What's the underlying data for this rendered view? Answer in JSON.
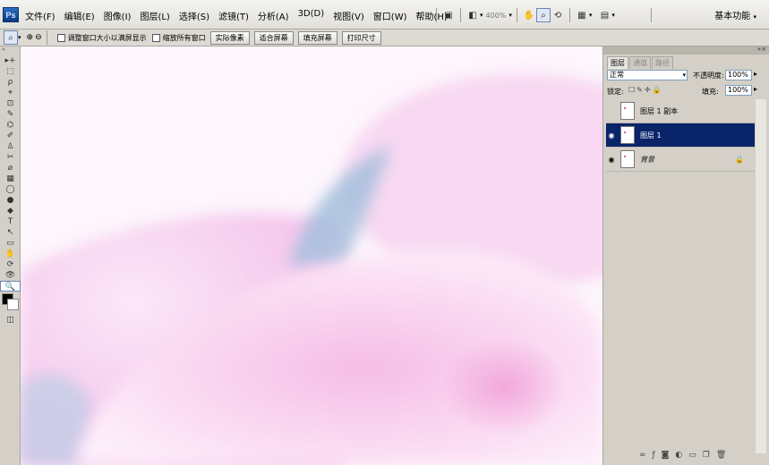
{
  "app": {
    "logo": "Ps"
  },
  "menu": [
    "文件(F)",
    "编辑(E)",
    "图像(I)",
    "图层(L)",
    "选择(S)",
    "滤镜(T)",
    "分析(A)",
    "3D(D)",
    "视图(V)",
    "窗口(W)",
    "帮助(H)"
  ],
  "menubar_tools": {
    "zoom_level": "400%",
    "workspace": "基本功能"
  },
  "options": {
    "check_resize": "调整窗口大小以满屏显示",
    "check_zoom_all": "缩放所有窗口",
    "btn_actual": "实际像素",
    "btn_fit": "适合屏幕",
    "btn_fill": "填充屏幕",
    "btn_print": "打印尺寸"
  },
  "tools": [
    "▸+",
    "⬚",
    "ρ",
    "⌖",
    "⊡",
    "✎",
    "⌬",
    "✐",
    "♙",
    "✂",
    "⌀",
    "▦",
    "◯",
    "●",
    "◆",
    "T",
    "↖",
    "▭",
    "✋",
    "⟳",
    "👁",
    "🔍"
  ],
  "panel": {
    "tabs": [
      "图层",
      "通道",
      "路径"
    ],
    "blend_mode": "正常",
    "opacity_label": "不透明度:",
    "opacity": "100%",
    "lock_label": "锁定:",
    "fill_label": "填充:",
    "fill": "100%",
    "layers": [
      {
        "name": "图层 1 副本",
        "visible": false,
        "selected": false
      },
      {
        "name": "图层 1",
        "visible": true,
        "selected": true
      },
      {
        "name": "背景",
        "visible": true,
        "selected": false,
        "locked": true
      }
    ],
    "bottom_icons": [
      "link-icon",
      "fx-icon",
      "mask-icon",
      "adjustment-icon",
      "group-icon",
      "new-layer-icon",
      "trash-icon"
    ]
  }
}
